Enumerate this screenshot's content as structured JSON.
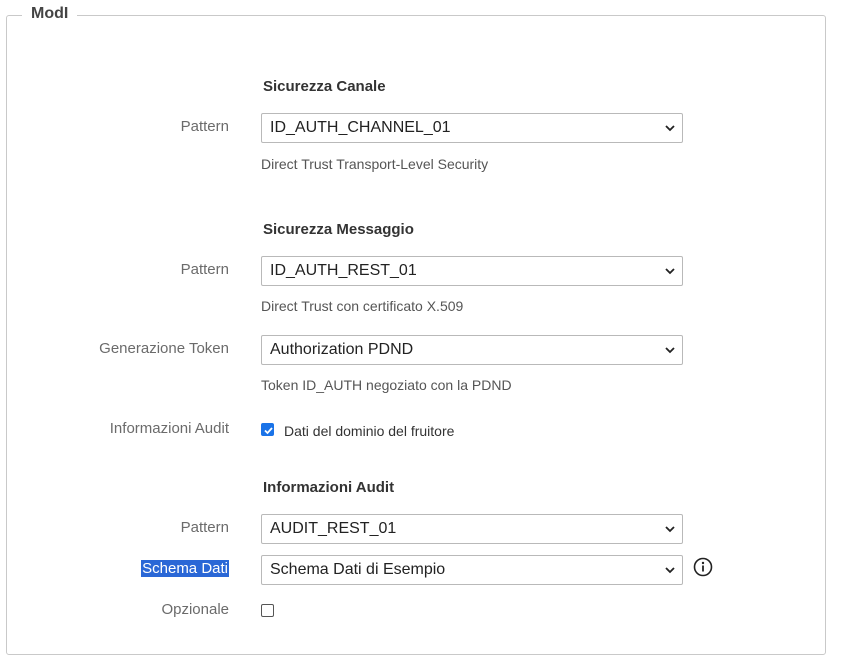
{
  "legend": "ModI",
  "channel": {
    "title": "Sicurezza Canale",
    "pattern_label": "Pattern",
    "pattern_value": "ID_AUTH_CHANNEL_01",
    "pattern_help": "Direct Trust Transport-Level Security"
  },
  "message": {
    "title": "Sicurezza Messaggio",
    "pattern_label": "Pattern",
    "pattern_value": "ID_AUTH_REST_01",
    "pattern_help": "Direct Trust con certificato X.509",
    "token_label": "Generazione Token",
    "token_value": "Authorization PDND",
    "token_help": "Token ID_AUTH negoziato con la PDND",
    "audit_label": "Informazioni Audit",
    "audit_checkbox_label": "Dati del dominio del fruitore",
    "audit_checked": true
  },
  "audit": {
    "title": "Informazioni Audit",
    "pattern_label": "Pattern",
    "pattern_value": "AUDIT_REST_01",
    "schema_label": "Schema Dati",
    "schema_value": "Schema Dati di Esempio",
    "optional_label": "Opzionale",
    "optional_checked": false
  },
  "icons": {
    "info": "info-circle-icon",
    "dropdown": "chevron-down-icon",
    "check": "check-icon"
  },
  "colors": {
    "accent": "#1a73e8",
    "selection": "#2a67d6",
    "border": "#b9b9b9"
  }
}
